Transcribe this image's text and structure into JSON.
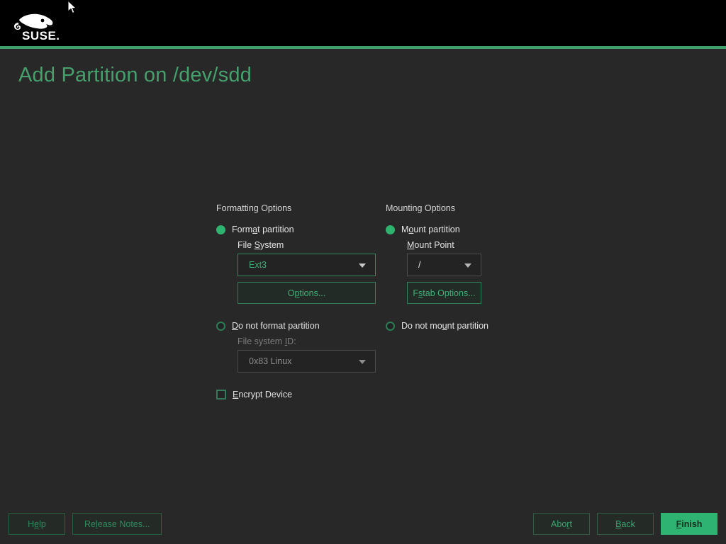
{
  "header": {
    "logo_alt": "SUSE",
    "wordmark": "SUSE."
  },
  "page_title": "Add Partition on /dev/sdd",
  "formatting": {
    "section_heading": "Formatting Options",
    "format_partition_label": "Format partition",
    "format_partition_selected": true,
    "file_system_label": "File System",
    "file_system_value": "Ext3",
    "options_button": "Options...",
    "do_not_format_label": "Do not format partition",
    "do_not_format_selected": false,
    "file_system_id_label": "File system ID:",
    "file_system_id_value": "0x83 Linux",
    "encrypt_device_label": "Encrypt Device",
    "encrypt_device_checked": false
  },
  "mounting": {
    "section_heading": "Mounting Options",
    "mount_partition_label": "Mount partition",
    "mount_partition_selected": true,
    "mount_point_label": "Mount Point",
    "mount_point_value": "/",
    "fstab_options_button": "Fstab Options...",
    "do_not_mount_label": "Do not mount partition",
    "do_not_mount_selected": false
  },
  "footer": {
    "help": "Help",
    "release_notes": "Release Notes...",
    "abort": "Abort",
    "back": "Back",
    "finish": "Finish"
  },
  "colors": {
    "accent_green": "#2fb372",
    "title_green": "#45a06c",
    "header_black": "#000000",
    "body_background": "#282828",
    "rule_green": "#3fa06a"
  }
}
